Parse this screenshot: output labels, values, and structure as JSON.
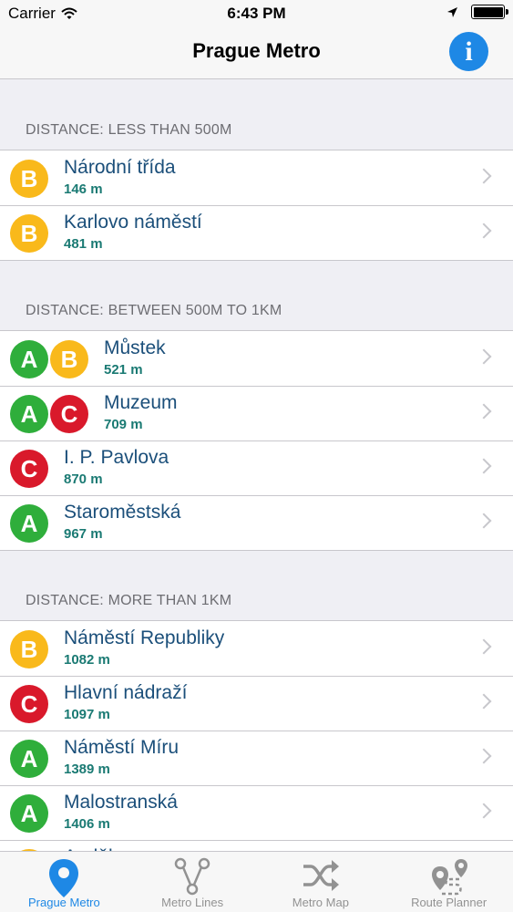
{
  "status_bar": {
    "carrier": "Carrier",
    "time": "6:43 PM"
  },
  "nav": {
    "title": "Prague Metro",
    "info_label": "i"
  },
  "sections": [
    {
      "header": "DISTANCE: LESS THAN 500M",
      "rows": [
        {
          "lines": [
            "B"
          ],
          "name": "Národní třída",
          "distance": "146 m"
        },
        {
          "lines": [
            "B"
          ],
          "name": "Karlovo náměstí",
          "distance": "481 m"
        }
      ]
    },
    {
      "header": "DISTANCE: BETWEEN 500M TO 1KM",
      "rows": [
        {
          "lines": [
            "A",
            "B"
          ],
          "name": "Můstek",
          "distance": "521 m"
        },
        {
          "lines": [
            "A",
            "C"
          ],
          "name": "Muzeum",
          "distance": "709 m"
        },
        {
          "lines": [
            "C"
          ],
          "name": "I. P. Pavlova",
          "distance": "870 m"
        },
        {
          "lines": [
            "A"
          ],
          "name": "Staroměstská",
          "distance": "967 m"
        }
      ]
    },
    {
      "header": "DISTANCE: MORE THAN 1KM",
      "rows": [
        {
          "lines": [
            "B"
          ],
          "name": "Náměstí Republiky",
          "distance": "1082 m"
        },
        {
          "lines": [
            "C"
          ],
          "name": "Hlavní nádraží",
          "distance": "1097 m"
        },
        {
          "lines": [
            "A"
          ],
          "name": "Náměstí Míru",
          "distance": "1389 m"
        },
        {
          "lines": [
            "A"
          ],
          "name": "Malostranská",
          "distance": "1406 m"
        },
        {
          "lines": [
            "B"
          ],
          "name": "Anděl",
          "distance": ""
        }
      ]
    }
  ],
  "tabs": [
    {
      "label": "Prague Metro",
      "icon": "location-pin-icon",
      "active": true
    },
    {
      "label": "Metro Lines",
      "icon": "metro-lines-icon",
      "active": false
    },
    {
      "label": "Metro Map",
      "icon": "shuffle-icon",
      "active": false
    },
    {
      "label": "Route Planner",
      "icon": "route-planner-icon",
      "active": false
    }
  ],
  "colors": {
    "line_A": "#2fae3b",
    "line_B": "#f9b91b",
    "line_C": "#d9192b",
    "accent": "#1e88e5",
    "station_text": "#1b4f7a",
    "distance_text": "#1a7a73"
  }
}
